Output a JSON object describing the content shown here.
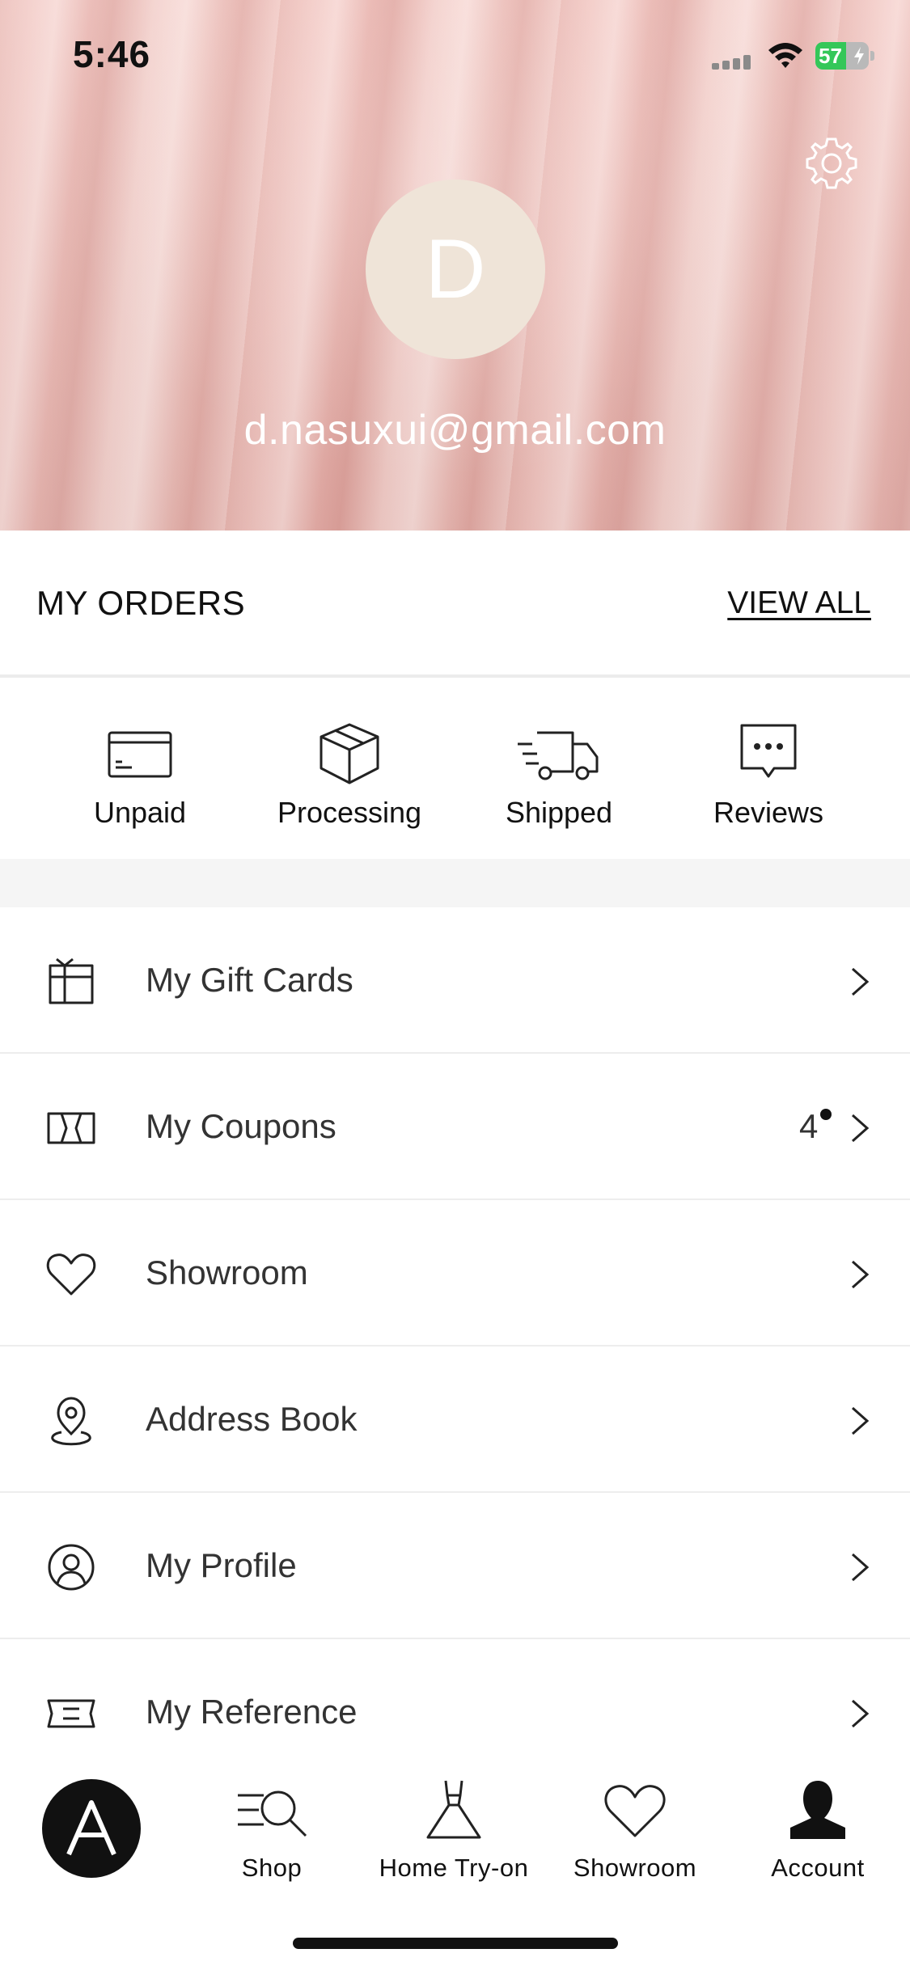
{
  "status_bar": {
    "time": "5:46",
    "battery_level": "57"
  },
  "profile": {
    "avatar_initial": "D",
    "email": "d.nasuxui@gmail.com"
  },
  "orders": {
    "title": "MY ORDERS",
    "view_all": "VIEW ALL",
    "items": [
      {
        "label": "Unpaid",
        "icon": "card-icon"
      },
      {
        "label": "Processing",
        "icon": "box-icon"
      },
      {
        "label": "Shipped",
        "icon": "truck-icon"
      },
      {
        "label": "Reviews",
        "icon": "chat-bubble-icon"
      }
    ]
  },
  "menu": {
    "items": [
      {
        "label": "My Gift Cards",
        "icon": "gift-card-icon"
      },
      {
        "label": "My Coupons",
        "icon": "coupon-icon",
        "count": "4"
      },
      {
        "label": "Showroom",
        "icon": "heart-icon"
      },
      {
        "label": "Address Book",
        "icon": "location-pin-icon"
      },
      {
        "label": "My Profile",
        "icon": "user-circle-icon"
      },
      {
        "label": "My Reference",
        "icon": "ticket-icon"
      }
    ]
  },
  "tabbar": {
    "brand": "A",
    "items": [
      {
        "label": "Shop",
        "icon": "search-list-icon"
      },
      {
        "label": "Home Try-on",
        "icon": "dress-icon"
      },
      {
        "label": "Showroom",
        "icon": "heart-icon"
      },
      {
        "label": "Account",
        "icon": "person-icon"
      }
    ]
  },
  "colors": {
    "battery_green": "#34c759",
    "avatar_bg": "#efe4d8",
    "header_pink": "#f1c4bf"
  }
}
